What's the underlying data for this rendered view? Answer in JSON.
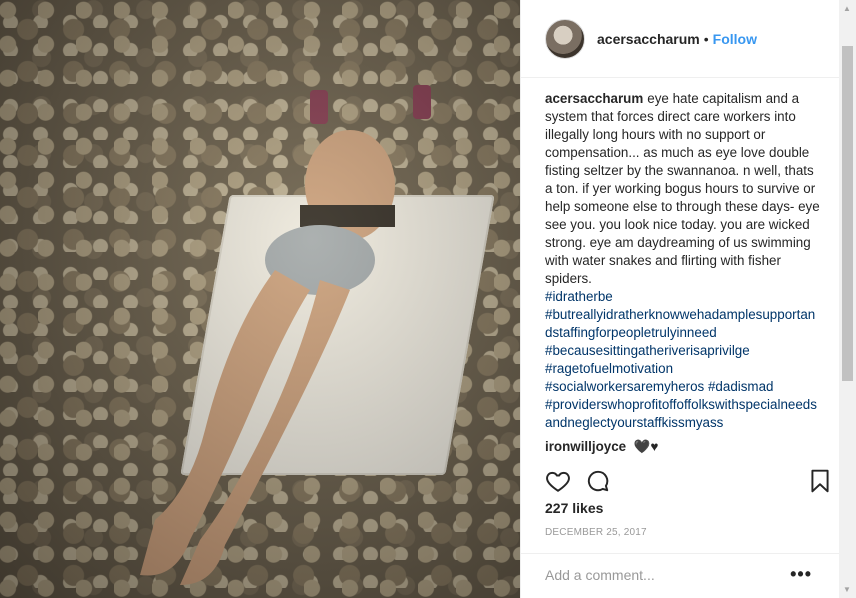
{
  "post": {
    "username": "acersaccharum",
    "separator": "•",
    "follow_label": "Follow",
    "caption_user": "acersaccharum",
    "caption_text": "eye hate capitalism and a system that forces direct care workers into illegally long hours with no support or compensation... as much as eye love double fisting seltzer by the swannanoa. n well, thats a ton. if yer working bogus hours to survive or help someone else to through these days- eye see you. you look nice today. you are wicked strong. eye am daydreaming of us swimming with water snakes and flirting with fisher spiders.",
    "hashtags": [
      "#idratherbe",
      "#butreallyidratherknowwehadamplesupportandstaffingforpeopletrulyinneed",
      "#becausesittingatheriverisaprivilge",
      "#ragetofuelmotivation",
      "#socialworkersaremyheros #dadismad",
      "#providerswhoprofitoffoffolkswithspecialneedsandneglectyourstaffkissmyass"
    ],
    "comment2_user": "ironwilljoyce",
    "comment2_text": "🖤♥",
    "likes": "227 likes",
    "date": "DECEMBER 25, 2017",
    "add_comment_placeholder": "Add a comment...",
    "more_label": "•••"
  },
  "icons": {
    "like": "heart-outline-icon",
    "comment": "speech-bubble-icon",
    "save": "bookmark-icon",
    "more": "ellipsis-icon"
  },
  "colors": {
    "link_blue": "#3897f0",
    "hashtag_blue": "#003569",
    "muted": "#999999",
    "border": "#efefef"
  }
}
